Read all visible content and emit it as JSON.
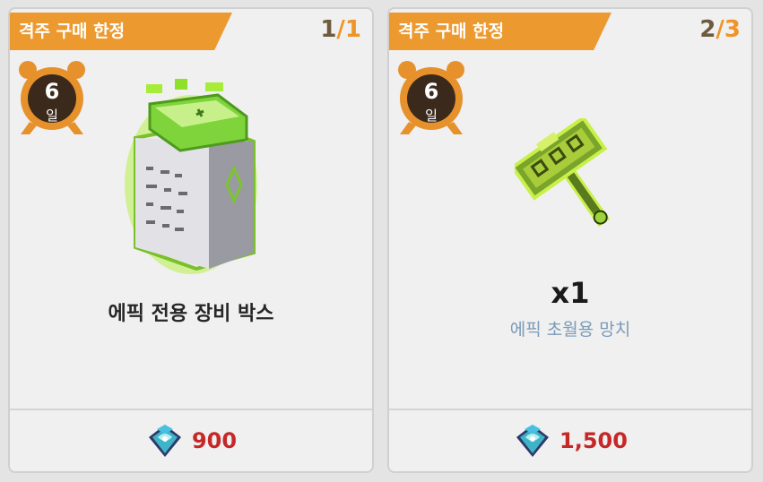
{
  "colors": {
    "ribbon": "#ec9a2f",
    "price": "#c62828",
    "subtext": "#7a9ab8",
    "counter_current": "#6e5a3e",
    "counter_limit": "#ef9427"
  },
  "cards": [
    {
      "ribbon_label": "격주 구매 한정",
      "counter_current": "1",
      "counter_sep": "/",
      "counter_limit": "1",
      "timer_value": "6",
      "timer_unit": "일",
      "item_name": "에픽 전용 장비 박스",
      "item_icon": "equipment-box-icon",
      "price_icon": "crystal-currency-icon",
      "price": "900"
    },
    {
      "ribbon_label": "격주 구매 한정",
      "counter_current": "2",
      "counter_sep": "/",
      "counter_limit": "3",
      "timer_value": "6",
      "timer_unit": "일",
      "quantity": "x1",
      "item_name": "에픽 초월용 망치",
      "item_icon": "hammer-icon",
      "price_icon": "crystal-currency-icon",
      "price": "1,500"
    }
  ]
}
